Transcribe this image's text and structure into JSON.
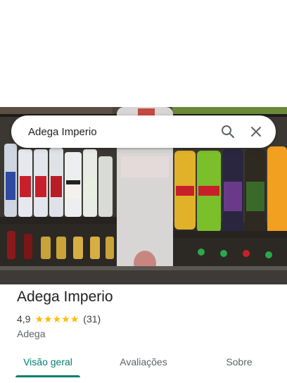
{
  "search": {
    "query": "Adega Imperio"
  },
  "hero": {
    "photo_subject": "liquor-shelf-photo"
  },
  "place": {
    "name": "Adega Imperio",
    "rating": "4,9",
    "stars": 5,
    "review_count": "(31)",
    "category": "Adega"
  },
  "tabs": [
    {
      "label": "Visão geral",
      "active": true
    },
    {
      "label": "Avaliações",
      "active": false
    },
    {
      "label": "Sobre",
      "active": false
    }
  ],
  "colors": {
    "accent": "#00806f",
    "star": "#fbbc04"
  },
  "icons": {
    "search": "search-icon",
    "close": "close-icon"
  }
}
